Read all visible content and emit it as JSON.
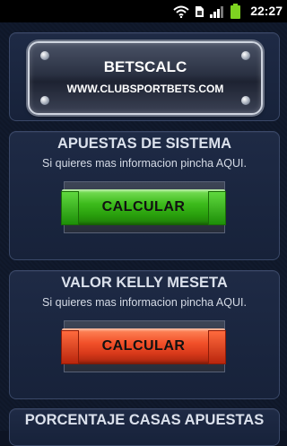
{
  "status_bar": {
    "time": "22:27",
    "icons": [
      "wifi-icon",
      "sim-icon",
      "signal-icon",
      "battery-icon"
    ]
  },
  "header": {
    "title": "BETSCALC",
    "url": "WWW.CLUBSPORTBETS.COM"
  },
  "sections": [
    {
      "title": "APUESTAS DE SISTEMA",
      "subtitle": "Si quieres mas informacion pincha AQUI.",
      "button": "CALCULAR",
      "button_color": "#3dbb1c"
    },
    {
      "title": "VALOR KELLY MESETA",
      "subtitle": "Si quieres mas informacion pincha AQUI.",
      "button": "CALCULAR",
      "button_color": "#f2512a"
    },
    {
      "title": "PORCENTAJE CASAS APUESTAS"
    }
  ],
  "colors": {
    "status_battery": "#7ed321",
    "background": "#0d1424"
  }
}
